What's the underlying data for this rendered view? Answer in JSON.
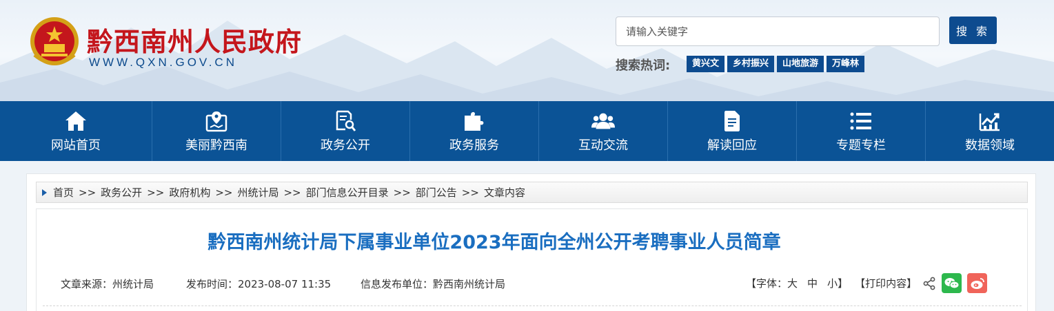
{
  "header": {
    "site_name": "黔西南州人民政府",
    "site_url": "WWW.QXN.GOV.CN",
    "search": {
      "placeholder": "请输入关键字",
      "button_label": "搜 索"
    },
    "hot_label": "搜索热词:",
    "hot_tags": [
      "黄兴文",
      "乡村振兴",
      "山地旅游",
      "万峰林"
    ]
  },
  "nav": {
    "items": [
      {
        "label": "网站首页",
        "icon": "home-icon"
      },
      {
        "label": "美丽黔西南",
        "icon": "map-pin-icon"
      },
      {
        "label": "政务公开",
        "icon": "document-search-icon"
      },
      {
        "label": "政务服务",
        "icon": "puzzle-icon"
      },
      {
        "label": "互动交流",
        "icon": "users-icon"
      },
      {
        "label": "解读回应",
        "icon": "file-icon"
      },
      {
        "label": "专题专栏",
        "icon": "list-icon"
      },
      {
        "label": "数据领域",
        "icon": "chart-icon"
      }
    ]
  },
  "breadcrumb": {
    "items": [
      "首页",
      "政务公开",
      "政府机构",
      "州统计局",
      "部门信息公开目录",
      "部门公告",
      "文章内容"
    ],
    "separator": ">>"
  },
  "article": {
    "title": "黔西南州统计局下属事业单位2023年面向全州公开考聘事业人员简章",
    "source": "文章来源：州统计局",
    "time": "发布时间：2023-08-07 11:35",
    "unit": "信息发布单位：黔西南州统计局"
  },
  "tools": {
    "font_label": "【字体：",
    "font_large": "大",
    "font_medium": "中",
    "font_small": "小",
    "font_close": "】",
    "print_label": "【打印内容】",
    "share_icon": "share-icon",
    "wechat_icon": "wechat-icon",
    "weibo_icon": "weibo-icon"
  },
  "colors": {
    "brand_red": "#c4161c",
    "nav_blue": "#0b5396",
    "title_blue": "#1a6ec0"
  }
}
